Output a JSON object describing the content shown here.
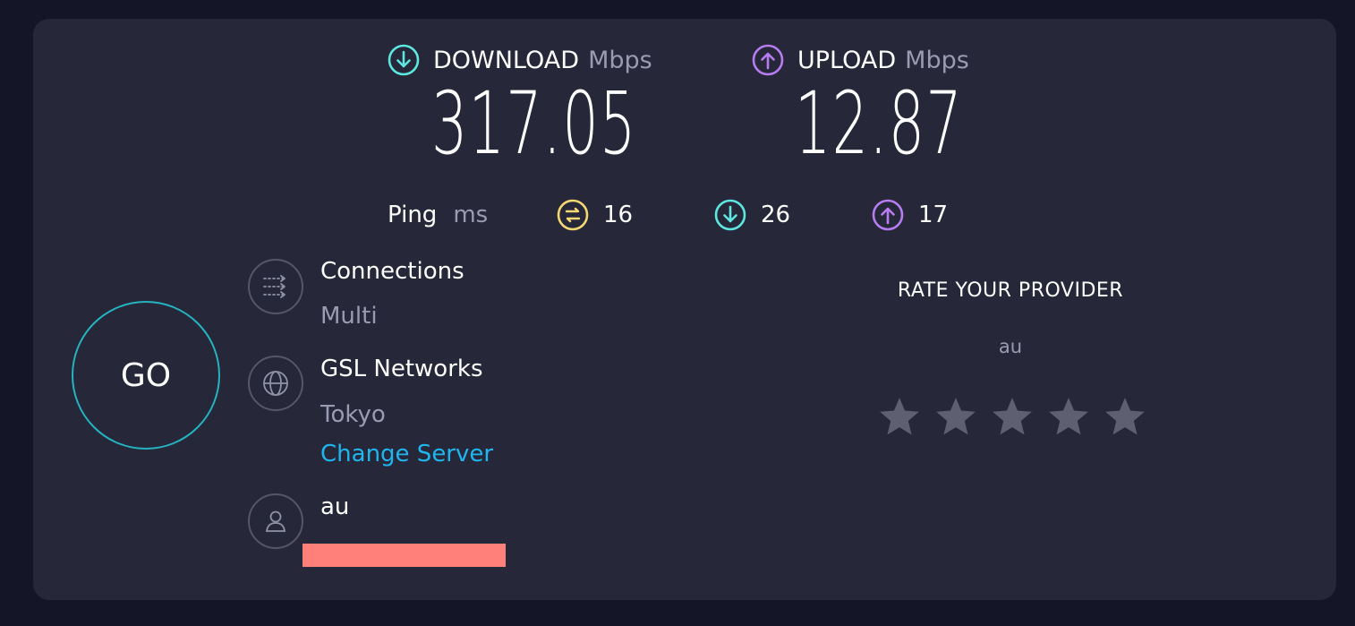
{
  "download": {
    "label": "DOWNLOAD",
    "unit": "Mbps",
    "value": "317.05",
    "icon": "arrow-down-circle-icon",
    "color": "#5ee6e0"
  },
  "upload": {
    "label": "UPLOAD",
    "unit": "Mbps",
    "value": "12.87",
    "icon": "arrow-up-circle-icon",
    "color": "#b67cf2"
  },
  "ping": {
    "label": "Ping",
    "unit": "ms",
    "idle": {
      "value": "16",
      "icon": "ping-jitter-icon",
      "color": "#f3d773"
    },
    "download": {
      "value": "26",
      "icon": "arrow-down-circle-icon",
      "color": "#5ee6e0"
    },
    "upload": {
      "value": "17",
      "icon": "arrow-up-circle-icon",
      "color": "#b67cf2"
    }
  },
  "go_button": {
    "label": "GO",
    "ring_color": "#25b3c0"
  },
  "connections": {
    "title": "Connections",
    "value": "Multi",
    "icon": "connections-icon"
  },
  "server": {
    "title": "GSL Networks",
    "location": "Tokyo",
    "change_link": "Change Server",
    "icon": "globe-icon"
  },
  "provider": {
    "name": "au",
    "icon": "user-icon",
    "redaction_color": "#ff7f7b"
  },
  "rating": {
    "title": "RATE YOUR PROVIDER",
    "provider": "au",
    "stars": 5,
    "star_color": "#5e6072"
  }
}
